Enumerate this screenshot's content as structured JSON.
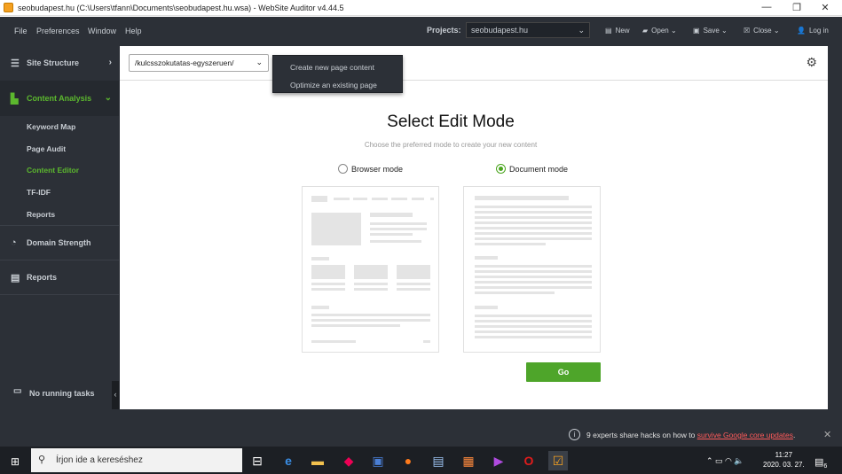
{
  "window": {
    "title": "seobudapest.hu (C:\\Users\\tfann\\Documents\\seobudapest.hu.wsa) - WebSite Auditor v4.44.5",
    "minimize": "—",
    "restore": "❐",
    "close": "✕"
  },
  "menu": {
    "file": "File",
    "preferences": "Preferences",
    "window": "Window",
    "help": "Help",
    "projects_label": "Projects:",
    "project_value": "seobudapest.hu",
    "toolbar": {
      "new": "New",
      "open": "Open",
      "save": "Save",
      "close": "Close",
      "login": "Log in"
    }
  },
  "sidebar": {
    "site_structure": "Site Structure",
    "content_analysis": "Content Analysis",
    "sub_items": [
      "Keyword Map",
      "Page Audit",
      "Content Editor",
      "TF-IDF",
      "Reports"
    ],
    "domain_strength": "Domain Strength",
    "reports": "Reports",
    "tasks": "No running tasks"
  },
  "editor": {
    "url": "/kulcsszokutatas-egyszeruen/",
    "popup_items": [
      "Create new page content",
      "Optimize an existing page"
    ],
    "heading": "Select Edit Mode",
    "subheading": "Choose the preferred mode to create your new content",
    "browser_mode": "Browser mode",
    "document_mode": "Document mode",
    "selected_mode": "Document mode",
    "go": "Go"
  },
  "notification": {
    "text": "9 experts share hacks on how to",
    "link": "survive Google core updates",
    "suffix": "."
  },
  "taskbar": {
    "search_placeholder": "Írjon ide a kereséshez",
    "time": "11:27",
    "date": "2020. 03. 27.",
    "notif_count": "6"
  },
  "colors": {
    "accent": "#4ea52a",
    "sidebar_bg": "#2c3037",
    "link_red": "#ff5a5a"
  }
}
